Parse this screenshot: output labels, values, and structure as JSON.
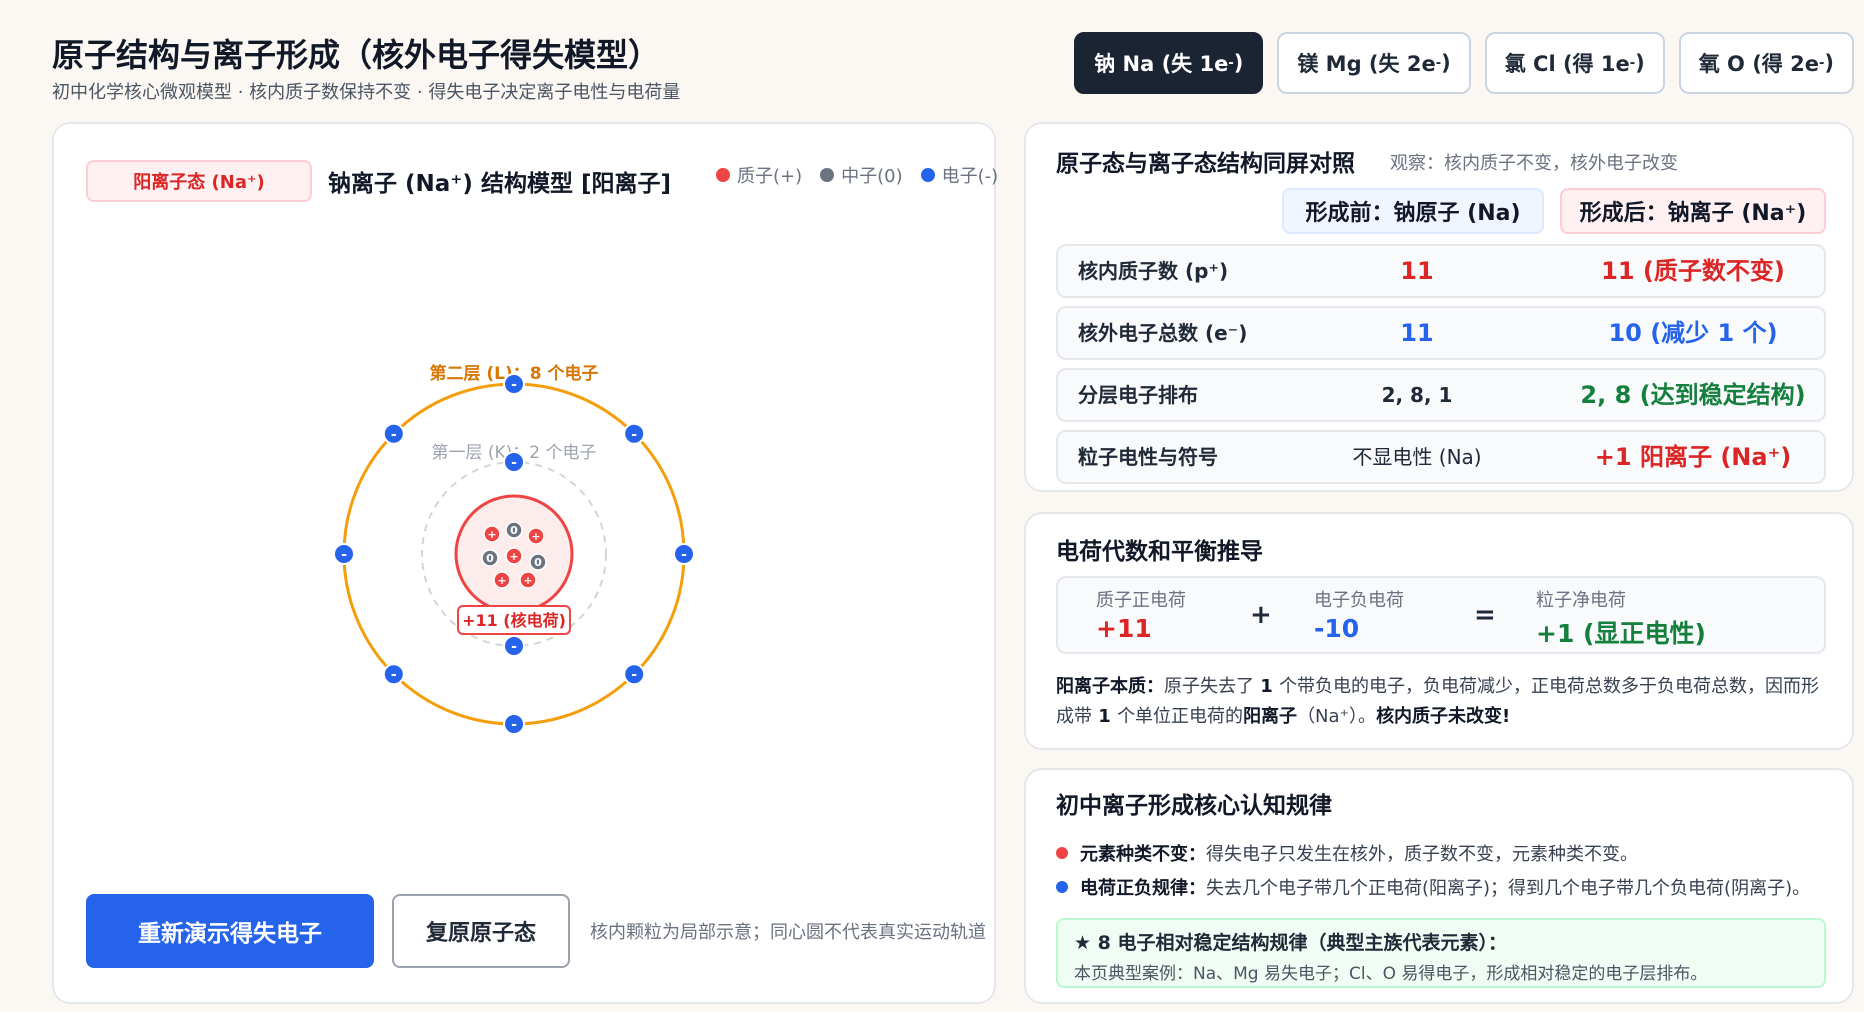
{
  "header": {
    "title": "原子结构与离子形成（核外电子得失模型）",
    "subtitle": "初中化学核心微观模型 · 核内质子数保持不变 · 得失电子决定离子电性与电荷量"
  },
  "tabs": [
    {
      "name": "钠 Na (失 1e",
      "sup": "-",
      "close": ")",
      "active": true
    },
    {
      "name": "镁 Mg (失 2e",
      "sup": "-",
      "close": ")",
      "active": false
    },
    {
      "name": "氯 Cl (得 1e",
      "sup": "-",
      "close": ")",
      "active": false
    },
    {
      "name": "氧 O (得 2e",
      "sup": "-",
      "close": ")",
      "active": false
    }
  ],
  "model": {
    "state_badge": "阳离子态 (Na⁺)",
    "title": "钠离子 (Na⁺) 结构模型 [阳离子]",
    "legend": [
      {
        "label": "质子(+)",
        "color": "#ef4444"
      },
      {
        "label": "中子(0)",
        "color": "#6b7280"
      },
      {
        "label": "电子(-)",
        "color": "#2563eb"
      }
    ],
    "shell1_label": "第一层 (K)：2 个电子",
    "shell2_label": "第二层 (L)：8 个电子",
    "nucleus_label": "+11 (核电荷)",
    "shell1_electron_count": 2,
    "shell2_electron_count": 8,
    "colors": {
      "shell2": "#f59e0b",
      "shell1": "#d1d5db",
      "nucleus_fill": "#fdecec",
      "nucleus_stroke": "#ef4444",
      "electron": "#2563eb",
      "proton": "#ef4444",
      "neutron": "#6b7280"
    },
    "electron_symbol": "-",
    "proton_symbol": "+",
    "neutron_symbol": "0",
    "replay_button": "重新演示得失电子",
    "reset_button": "复原原子态",
    "note": "核内颗粒为局部示意；同心圆不代表真实运动轨道"
  },
  "compare": {
    "title": "原子态与离子态结构同屏对照",
    "hint": "观察：核内质子不变，核外电子改变",
    "col_before": "形成前：钠原子 (Na)",
    "col_after": "形成后：钠离子 (Na⁺)",
    "rows": [
      {
        "label": "核内质子数 (p⁺)",
        "before": "11",
        "after": "11 (质子数不变)"
      },
      {
        "label": "核外电子总数 (e⁻)",
        "before": "11",
        "after": "10 (减少 1 个)"
      },
      {
        "label": "分层电子排布",
        "before": "2, 8, 1",
        "after": "2, 8 (达到稳定结构)"
      },
      {
        "label": "粒子电性与符号",
        "before": "不显电性 (Na)",
        "after": "+1 阳离子 (Na⁺)"
      }
    ]
  },
  "charge": {
    "title": "电荷代数和平衡推导",
    "proton_label": "质子正电荷",
    "proton_value": "+11",
    "plus": "+",
    "electron_label": "电子负电荷",
    "electron_value": "-10",
    "equals": "=",
    "net_label": "粒子净电荷",
    "net_value": "+1 (显正电性)",
    "essence_bold": "阳离子本质：",
    "essence_1": "原子失去了",
    "essence_n1": " 1 ",
    "essence_2": "个带负电的电子，负电荷减少，正电荷总数多于负电荷总数，因而形成带",
    "essence_n2": " 1 ",
    "essence_3": "个单位正电荷的",
    "essence_ion": "阳离子",
    "essence_4": "（Na⁺）。",
    "essence_end": "核内质子未改变!"
  },
  "rules": {
    "title": "初中离子形成核心认知规律",
    "items": [
      {
        "bold": "元素种类不变：",
        "text": "得失电子只发生在核外，质子数不变，元素种类不变。",
        "color": "#ef4444"
      },
      {
        "bold": "电荷正负规律：",
        "text": "失去几个电子带几个正电荷(阳离子)；得到几个电子带几个负电荷(阴离子)。",
        "color": "#2563eb"
      }
    ],
    "star_icon": "★",
    "star_title": "8 电子相对稳定结构规律（典型主族代表元素）：",
    "star_text": "本页典型案例：Na、Mg 易失电子；Cl、O 易得电子，形成相对稳定的电子层排布。"
  }
}
